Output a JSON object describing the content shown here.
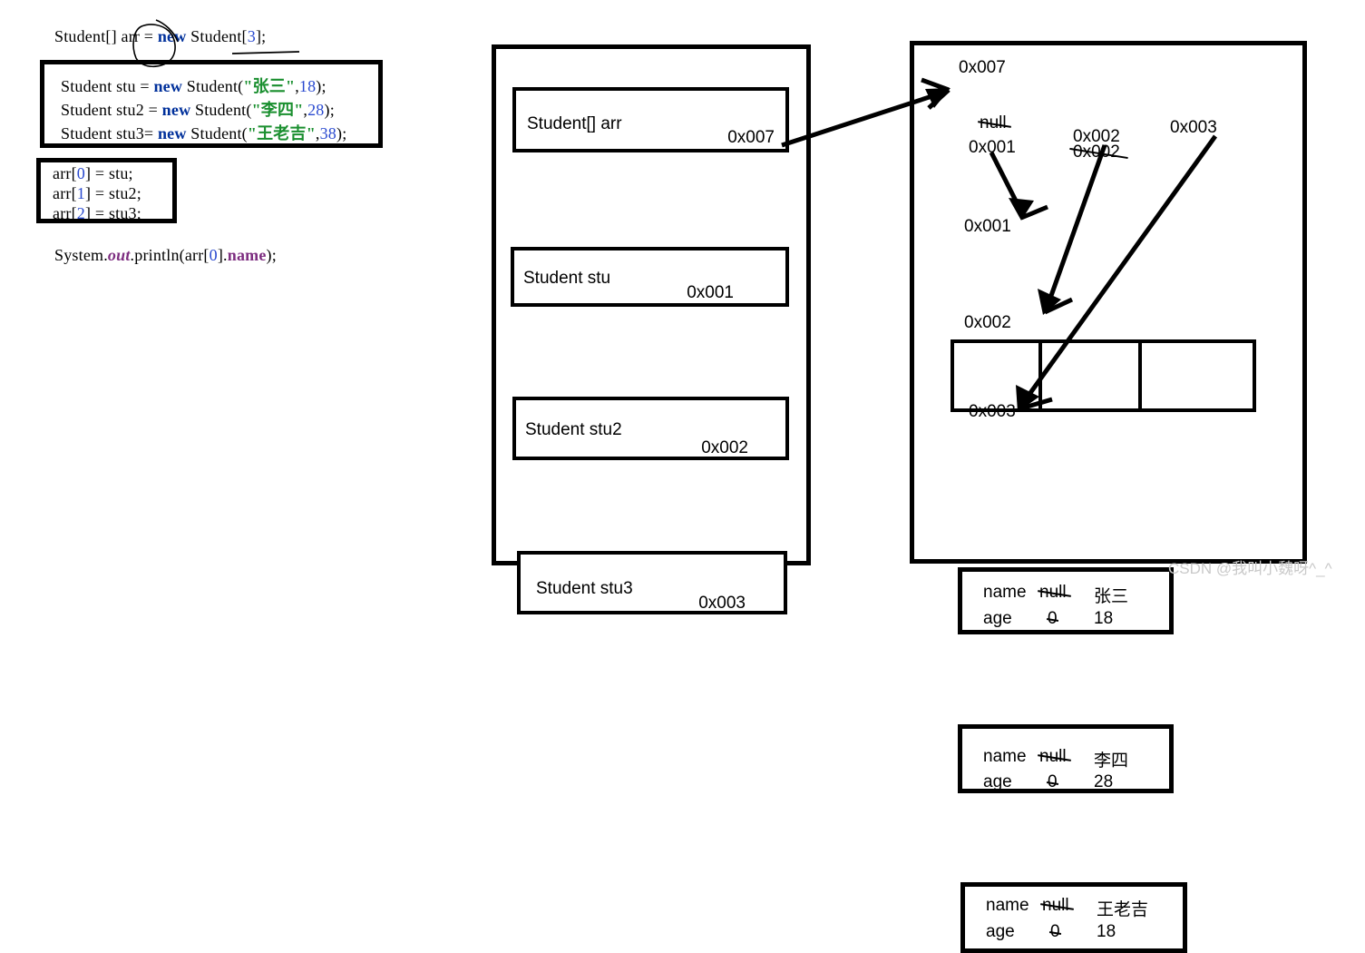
{
  "code": {
    "line_declare": {
      "pre": "Student[] ",
      "var": "arr",
      "eq": " = ",
      "kw": "new",
      "type": " Student[",
      "size": "3",
      "end": "];"
    },
    "box_objects": {
      "lines": [
        {
          "pre": "Student stu = ",
          "kw": "new",
          "mid": " Student(",
          "quote_open": "\"",
          "str": "张三",
          "quote_close": "\"",
          "comma": ",",
          "num": "18",
          "end": ");"
        },
        {
          "pre": "Student stu2 = ",
          "kw": "new",
          "mid": " Student(",
          "quote_open": "\"",
          "str": "李四",
          "quote_close": "\"",
          "comma": ",",
          "num": "28",
          "end": ");"
        },
        {
          "pre": "Student stu3= ",
          "kw": "new",
          "mid": " Student(",
          "quote_open": "\"",
          "str": "王老吉",
          "quote_close": "\"",
          "comma": ",",
          "num": "38",
          "end": ");"
        }
      ]
    },
    "box_assign": {
      "lines": [
        {
          "pre": "arr[",
          "idx": "0",
          "mid": "] = ",
          "end": "stu;"
        },
        {
          "pre": "arr[",
          "idx": "1",
          "mid": "] = ",
          "end": "stu2;"
        },
        {
          "pre": "arr[",
          "idx": "2",
          "mid": "] = ",
          "end": "stu3;"
        }
      ]
    },
    "line_print": {
      "a": "System.",
      "out": "out",
      "b": ".println(arr[",
      "idx": "0",
      "c": "].",
      "field": "name",
      "d": ");"
    }
  },
  "stack": {
    "slots": [
      {
        "label": "Student[]  arr",
        "address": "0x007"
      },
      {
        "label": "Student   stu",
        "address": "0x001"
      },
      {
        "label": "Student  stu2",
        "address": "0x002"
      },
      {
        "label": "Student  stu3",
        "address": "0x003"
      }
    ]
  },
  "heap": {
    "array_label": "0x007",
    "array_cells": [
      {
        "old": "null",
        "new": "0x001"
      },
      {
        "old": "0x002",
        "new": "0x002"
      },
      {
        "old": "",
        "new": "0x003"
      }
    ],
    "objects": [
      {
        "address": "0x001",
        "field1_name": "name",
        "field1_old": "null",
        "field1_new": "张三",
        "field2_name": "age",
        "field2_old": "0",
        "field2_new": "18"
      },
      {
        "address": "0x002",
        "field1_name": "name",
        "field1_old": "null",
        "field1_new": "李四",
        "field2_name": "age",
        "field2_old": "0",
        "field2_new": "28"
      },
      {
        "address": "0x003",
        "field1_name": "name",
        "field1_old": "null",
        "field1_new": "王老吉",
        "field2_name": "age",
        "field2_old": "0",
        "field2_new": "18"
      }
    ]
  },
  "watermark": {
    "text": "CSDN @我叫小魏呀^_^"
  },
  "colors": {
    "keyword": "#00309b",
    "string": "#1a8f2f",
    "number": "#2a4ad0",
    "field": "#7d2d80",
    "ink": "#000000",
    "watermark": "#c9c9c9"
  }
}
